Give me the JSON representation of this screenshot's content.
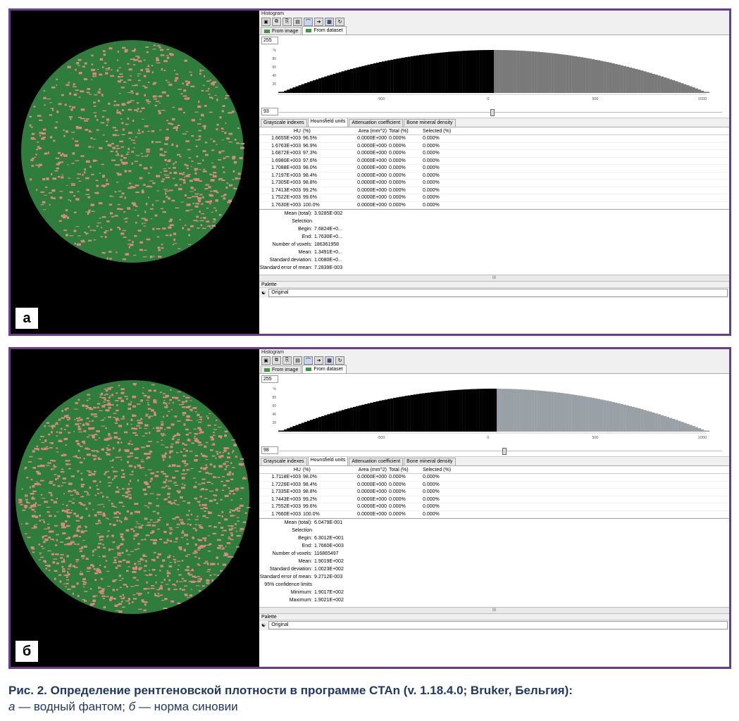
{
  "panels": [
    {
      "letter": "а",
      "window_title": "Histogram",
      "tabs": [
        "From image",
        "From dataset"
      ],
      "hist_top": "255",
      "hist_bottom": "93",
      "y_ticks": [
        "%",
        "80",
        "60",
        "40",
        "20"
      ],
      "x_ticks": [
        "-500",
        "0",
        "500",
        "1000"
      ],
      "split_fraction": 0.5,
      "subtabs": [
        "Grayscale indexes",
        "Hounsfield units",
        "Attenuation coefficient",
        "Bone mineral density"
      ],
      "columns": [
        "HU",
        "(%)",
        "Area (mm^2)",
        "Total (%)",
        "Selected (%)"
      ],
      "rows": [
        [
          "1.6655E+003",
          "96.5%",
          "0.0000E+000",
          "0.000%",
          "0.000%"
        ],
        [
          "1.6763E+003",
          "96.9%",
          "0.0000E+000",
          "0.000%",
          "0.000%"
        ],
        [
          "1.6872E+003",
          "97.3%",
          "0.0000E+000",
          "0.000%",
          "0.000%"
        ],
        [
          "1.6980E+003",
          "97.6%",
          "0.0000E+000",
          "0.000%",
          "0.000%"
        ],
        [
          "1.7088E+003",
          "98.0%",
          "0.0000E+000",
          "0.000%",
          "0.000%"
        ],
        [
          "1.7197E+003",
          "98.4%",
          "0.0000E+000",
          "0.000%",
          "0.000%"
        ],
        [
          "1.7305E+003",
          "98.8%",
          "0.0000E+000",
          "0.000%",
          "0.000%"
        ],
        [
          "1.7413E+003",
          "99.2%",
          "0.0000E+000",
          "0.000%",
          "0.000%"
        ],
        [
          "1.7522E+003",
          "99.6%",
          "0.0000E+000",
          "0.000%",
          "0.000%"
        ],
        [
          "1.7630E+003",
          "100.0%",
          "0.0000E+000",
          "0.000%",
          "0.000%"
        ]
      ],
      "stats": [
        [
          "Mean (total):",
          "3.9285E-002"
        ],
        [
          "Selection",
          ""
        ],
        [
          "Begin:",
          "7.6824E+0..."
        ],
        [
          "End:",
          "1.7630E+0..."
        ],
        [
          "Number of voxels:",
          "186361958"
        ],
        [
          "Mean:",
          "1.3491E+0..."
        ],
        [
          "Standard deviation:",
          "1.0080E+0..."
        ],
        [
          "Standard error of mean:",
          "7.2839E-003"
        ]
      ],
      "scroll_mark": "III",
      "palette_label": "Palette",
      "palette_value": "Original",
      "pink_ratio": 0.3
    },
    {
      "letter": "б",
      "window_title": "Histogram",
      "tabs": [
        "From image",
        "From dataset"
      ],
      "hist_top": "255",
      "hist_bottom": "98",
      "y_ticks": [
        "%",
        "80",
        "60",
        "40",
        "20"
      ],
      "x_ticks": [
        "-500",
        "0",
        "500",
        "1000"
      ],
      "split_fraction": 0.51,
      "subtabs": [
        "Grayscale indexes",
        "Hounsfield units",
        "Attenuation coefficient",
        "Bone mineral density"
      ],
      "columns": [
        "HU",
        "(%)",
        "Area (mm^2)",
        "Total (%)",
        "Selected (%)"
      ],
      "rows": [
        [
          "1.7118E+003",
          "98.0%",
          "0.0000E+000",
          "0.000%",
          "0.000%"
        ],
        [
          "1.7226E+003",
          "98.4%",
          "0.0000E+000",
          "0.000%",
          "0.000%"
        ],
        [
          "1.7335E+003",
          "98.8%",
          "0.0000E+000",
          "0.000%",
          "0.000%"
        ],
        [
          "1.7443E+003",
          "99.2%",
          "0.0000E+000",
          "0.000%",
          "0.000%"
        ],
        [
          "1.7552E+003",
          "99.6%",
          "0.0000E+000",
          "0.000%",
          "0.000%"
        ],
        [
          "1.7660E+003",
          "100.0%",
          "0.0000E+000",
          "0.000%",
          "0.000%"
        ]
      ],
      "stats": [
        [
          "Mean (total):",
          "6.0479E-001"
        ],
        [
          "Selection",
          ""
        ],
        [
          "Begin:",
          "6.3012E+001"
        ],
        [
          "End:",
          "1.7660E+003"
        ],
        [
          "Number of voxels:",
          "116865497"
        ],
        [
          "Mean:",
          "1.9019E+002"
        ],
        [
          "Standard deviation:",
          "1.0023E+002"
        ],
        [
          "Standard error of mean:",
          "9.2712E-003"
        ],
        [
          "95% confidence limits",
          ""
        ],
        [
          "Minimum:",
          "1.9017E+002"
        ],
        [
          "Maximum:",
          "1.9021E+002"
        ]
      ],
      "scroll_mark": "III",
      "palette_label": "Palette",
      "palette_value": "Original",
      "pink_ratio": 0.5
    }
  ],
  "caption": {
    "bold": "Рис. 2. Определение рентгеновской плотности в программе CTAn (v. 1.18.4.0; Bruker, Бельгия):",
    "a_letter": "а",
    "a_text": " — водный фантом; ",
    "b_letter": "б",
    "b_text": " — норма синовии"
  },
  "colors": {
    "frame": "#6a3c8e",
    "green": "#2f7d3c",
    "pink": "#d98a80",
    "caption": "#1f3864"
  }
}
